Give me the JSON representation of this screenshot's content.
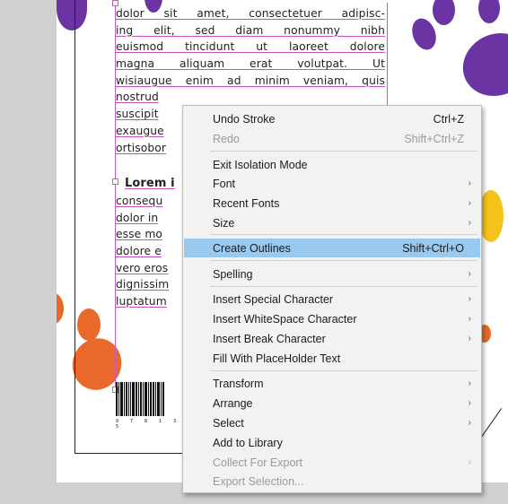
{
  "document": {
    "lines": [
      "dolor sit amet, consectetuer adipisc-",
      "ing elit, sed diam nonummy nibh",
      "euismod tincidunt ut laoreet dolore",
      "magna aliquam erat volutpat. Ut",
      "wisiaugue enim ad minim veniam, quis",
      "nostrud",
      "suscipit",
      "exaugue",
      "ortisobor"
    ],
    "heading": "Lorem i",
    "lines2": [
      "consequ",
      "dolor in",
      "esse mo",
      "dolore e",
      "vero eros",
      "dignissim",
      "luptatum"
    ],
    "barcode_digits": "9 7 8 1 3 5"
  },
  "context_menu": {
    "items": [
      {
        "label": "Undo Stroke",
        "shortcut": "Ctrl+Z",
        "submenu": false,
        "disabled": false,
        "highlighted": false
      },
      {
        "label": "Redo",
        "shortcut": "Shift+Ctrl+Z",
        "submenu": false,
        "disabled": true,
        "highlighted": false
      },
      {
        "label": "Exit Isolation Mode",
        "shortcut": "",
        "submenu": false,
        "disabled": false,
        "highlighted": false
      },
      {
        "label": "Font",
        "shortcut": "",
        "submenu": true,
        "disabled": false,
        "highlighted": false
      },
      {
        "label": "Recent Fonts",
        "shortcut": "",
        "submenu": true,
        "disabled": false,
        "highlighted": false
      },
      {
        "label": "Size",
        "shortcut": "",
        "submenu": true,
        "disabled": false,
        "highlighted": false
      },
      {
        "label": "Create Outlines",
        "shortcut": "Shift+Ctrl+O",
        "submenu": false,
        "disabled": false,
        "highlighted": true
      },
      {
        "label": "Spelling",
        "shortcut": "",
        "submenu": true,
        "disabled": false,
        "highlighted": false
      },
      {
        "label": "Insert Special Character",
        "shortcut": "",
        "submenu": true,
        "disabled": false,
        "highlighted": false
      },
      {
        "label": "Insert WhiteSpace Character",
        "shortcut": "",
        "submenu": true,
        "disabled": false,
        "highlighted": false
      },
      {
        "label": "Insert Break Character",
        "shortcut": "",
        "submenu": true,
        "disabled": false,
        "highlighted": false
      },
      {
        "label": "Fill With PlaceHolder Text",
        "shortcut": "",
        "submenu": false,
        "disabled": false,
        "highlighted": false
      },
      {
        "label": "Transform",
        "shortcut": "",
        "submenu": true,
        "disabled": false,
        "highlighted": false
      },
      {
        "label": "Arrange",
        "shortcut": "",
        "submenu": true,
        "disabled": false,
        "highlighted": false
      },
      {
        "label": "Select",
        "shortcut": "",
        "submenu": true,
        "disabled": false,
        "highlighted": false
      },
      {
        "label": "Add to Library",
        "shortcut": "",
        "submenu": false,
        "disabled": false,
        "highlighted": false
      },
      {
        "label": "Collect For Export",
        "shortcut": "",
        "submenu": true,
        "disabled": true,
        "highlighted": false
      },
      {
        "label": "Export Selection...",
        "shortcut": "",
        "submenu": false,
        "disabled": true,
        "highlighted": false
      }
    ],
    "submenu_arrow": "›"
  },
  "colors": {
    "menu_highlight": "#99c9ef",
    "selection": "#c858c8",
    "paw_purple": "#6a35a3",
    "paw_orange": "#e8692a",
    "paw_yellow": "#f5c21a"
  }
}
